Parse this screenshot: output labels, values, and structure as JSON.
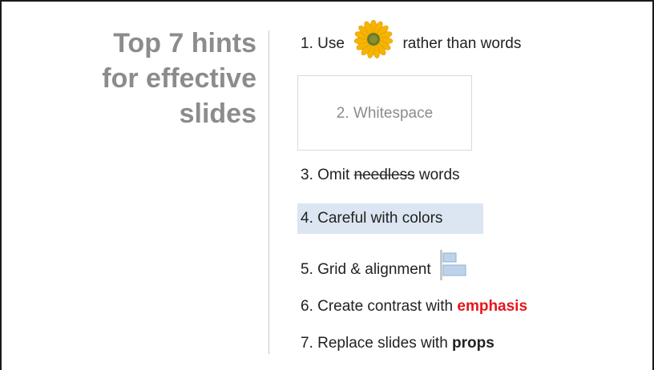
{
  "title": {
    "line1": "Top 7 hints",
    "line2": "for effective",
    "line3": "slides"
  },
  "hints": {
    "h1_before": "1. Use",
    "h1_icon": "sunflower-image",
    "h1_after": "rather than words",
    "h2": "2. Whitespace",
    "h3_before": "3. Omit",
    "h3_strike": "needless",
    "h3_after": "words",
    "h4": "4. Careful with colors",
    "h5": "5. Grid & alignment",
    "h5_icon": "alignment-icon",
    "h6_before": "6. Create contrast with",
    "h6_emph": "emphasis",
    "h7_before": "7. Replace slides with",
    "h7_bold": "props"
  },
  "colors": {
    "title": "#8c8c8c",
    "emphasis": "#e8141b",
    "highlight": "#dce6f2"
  }
}
